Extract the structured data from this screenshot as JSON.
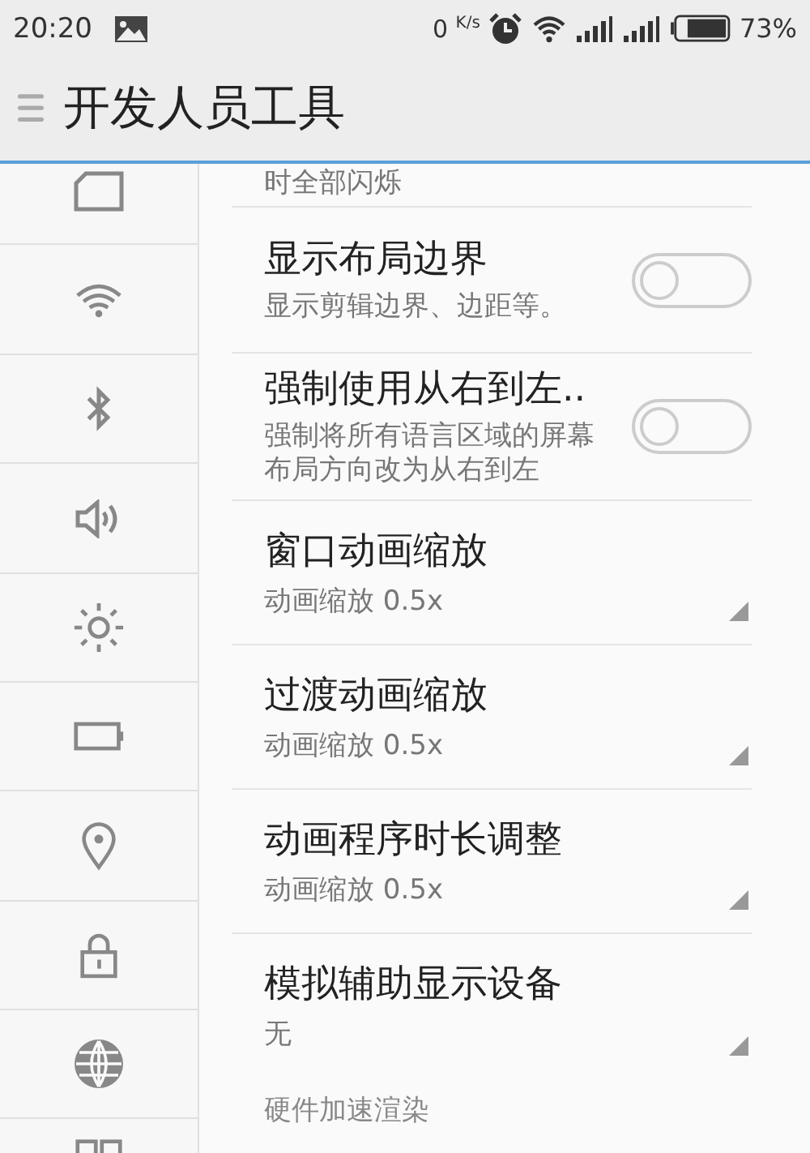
{
  "status_bar": {
    "time": "20:20",
    "net_speed": "0",
    "net_unit": "K/s",
    "battery": "73%"
  },
  "app_bar": {
    "title": "开发人员工具"
  },
  "sidebar": {
    "items": [
      {
        "kind": "sim"
      },
      {
        "kind": "wifi"
      },
      {
        "kind": "bluetooth"
      },
      {
        "kind": "volume"
      },
      {
        "kind": "brightness"
      },
      {
        "kind": "battery"
      },
      {
        "kind": "location"
      },
      {
        "kind": "lock"
      },
      {
        "kind": "globe"
      },
      {
        "kind": "grid"
      }
    ]
  },
  "settings": {
    "partial_text": "时全部闪烁",
    "items": [
      {
        "kind": "toggle",
        "title": "显示布局边界",
        "summary": "显示剪辑边界、边距等。",
        "on": false
      },
      {
        "kind": "toggle",
        "title": "强制使用从右到左..",
        "summary": "强制将所有语言区域的屏幕布局方向改为从右到左",
        "on": false
      },
      {
        "kind": "dropdown",
        "title": "窗口动画缩放",
        "summary": "动画缩放 0.5x"
      },
      {
        "kind": "dropdown",
        "title": "过渡动画缩放",
        "summary": "动画缩放 0.5x"
      },
      {
        "kind": "dropdown",
        "title": "动画程序时长调整",
        "summary": "动画缩放 0.5x"
      },
      {
        "kind": "dropdown",
        "title": "模拟辅助显示设备",
        "summary": "无"
      }
    ],
    "section_header": "硬件加速渲染"
  }
}
